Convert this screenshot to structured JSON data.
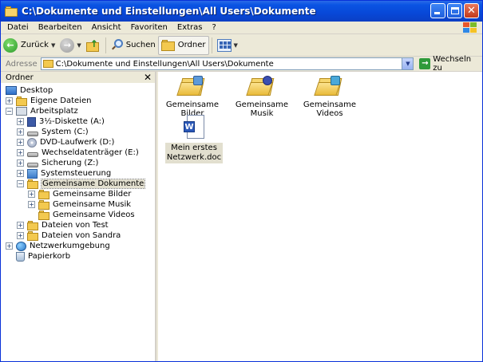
{
  "window": {
    "title": "C:\\Dokumente und Einstellungen\\All Users\\Dokumente"
  },
  "menu": [
    "Datei",
    "Bearbeiten",
    "Ansicht",
    "Favoriten",
    "Extras",
    "?"
  ],
  "toolbar": {
    "back_label": "Zurück",
    "search_label": "Suchen",
    "folders_label": "Ordner"
  },
  "address": {
    "label": "Adresse",
    "value": "C:\\Dokumente und Einstellungen\\All Users\\Dokumente",
    "go_label": "Wechseln zu"
  },
  "folder_pane": {
    "title": "Ordner",
    "tree": [
      "Desktop",
      "Eigene Dateien",
      "Arbeitsplatz",
      "3½-Diskette (A:)",
      "System (C:)",
      "DVD-Laufwerk (D:)",
      "Wechseldatenträger (E:)",
      "Sicherung (Z:)",
      "Systemsteuerung",
      "Gemeinsame Dokumente",
      "Gemeinsame Bilder",
      "Gemeinsame Musik",
      "Gemeinsame Videos",
      "Dateien von Test",
      "Dateien von Sandra",
      "Netzwerkumgebung",
      "Papierkorb"
    ]
  },
  "content": {
    "items": [
      {
        "label": "Gemeinsame Bilder",
        "icon": "folder-pictures-icon"
      },
      {
        "label": "Gemeinsame Musik",
        "icon": "folder-music-icon"
      },
      {
        "label": "Gemeinsame Videos",
        "icon": "folder-videos-icon"
      },
      {
        "label_line1": "Mein erstes",
        "label_line2": "Netzwerk.doc",
        "icon": "word-document-icon"
      }
    ]
  },
  "colors": {
    "titlebar": "#0a54e3",
    "selection": "#e2dfcf",
    "folder": "#f3c94f"
  }
}
